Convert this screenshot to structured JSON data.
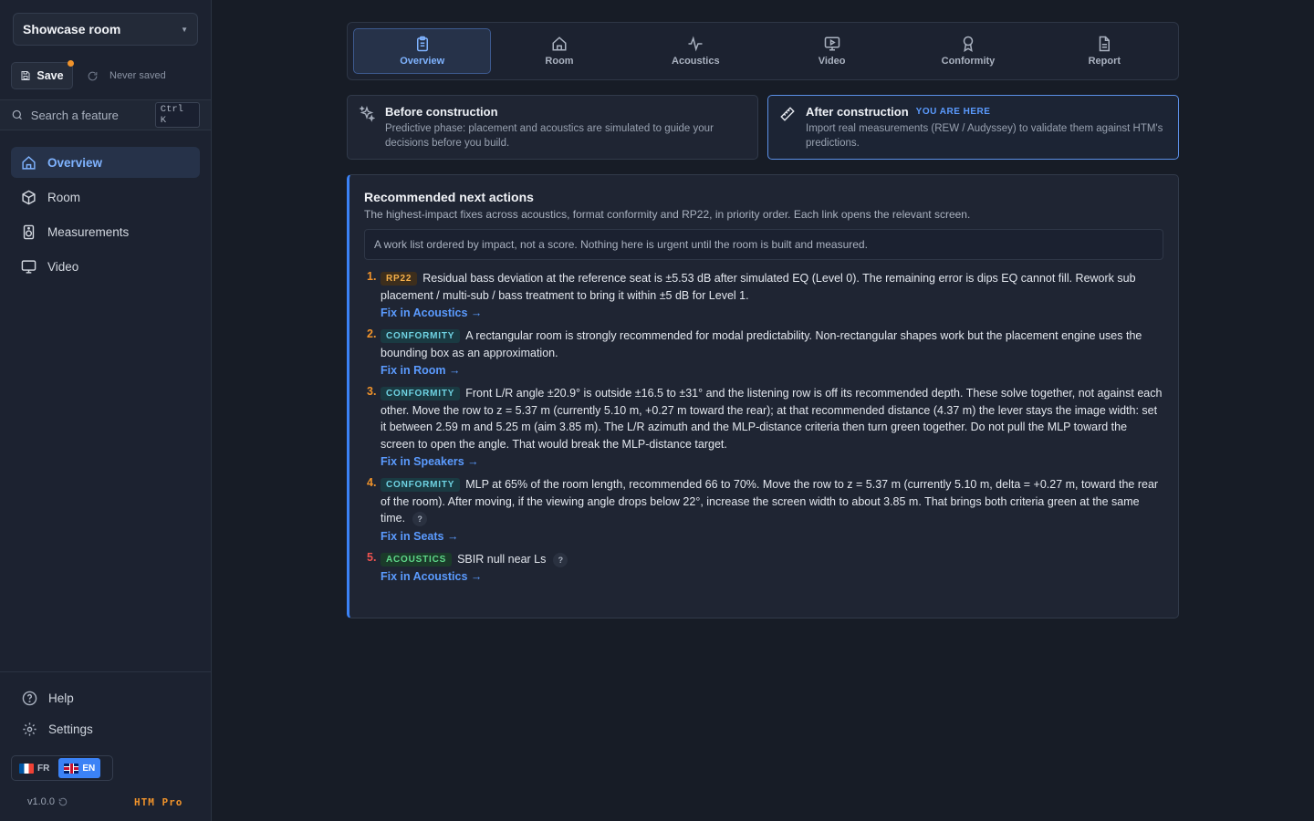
{
  "sidebar": {
    "room_selector": "Showcase room",
    "save_label": "Save",
    "save_status": "Never saved",
    "search_placeholder": "Search a feature",
    "search_shortcut": "Ctrl K",
    "nav": [
      {
        "label": "Overview",
        "icon": "home-icon",
        "active": true
      },
      {
        "label": "Room",
        "icon": "cube-icon",
        "active": false
      },
      {
        "label": "Measurements",
        "icon": "speaker-icon",
        "active": false
      },
      {
        "label": "Video",
        "icon": "monitor-icon",
        "active": false
      }
    ],
    "help_label": "Help",
    "settings_label": "Settings",
    "lang_fr": "FR",
    "lang_en": "EN",
    "version": "v1.0.0",
    "brand": "HTM Pro"
  },
  "tabs": [
    {
      "label": "Overview",
      "icon": "clipboard-icon",
      "active": true
    },
    {
      "label": "Room",
      "icon": "home-icon",
      "active": false
    },
    {
      "label": "Acoustics",
      "icon": "pulse-icon",
      "active": false
    },
    {
      "label": "Video",
      "icon": "video-icon",
      "active": false
    },
    {
      "label": "Conformity",
      "icon": "award-icon",
      "active": false
    },
    {
      "label": "Report",
      "icon": "document-icon",
      "active": false
    }
  ],
  "phases": {
    "before": {
      "title": "Before construction",
      "desc": "Predictive phase: placement and acoustics are simulated to guide your decisions before you build."
    },
    "after": {
      "title": "After construction",
      "tag": "YOU ARE HERE",
      "desc": "Import real measurements (REW / Audyssey) to validate them against HTM's predictions."
    }
  },
  "actions": {
    "title": "Recommended next actions",
    "subtitle": "The highest-impact fixes across acoustics, format conformity and RP22, in priority order. Each link opens the relevant screen.",
    "note": "A work list ordered by impact, not a score. Nothing here is urgent until the room is built and measured.",
    "items": [
      {
        "num": "1.",
        "badge": "RP22",
        "text": "Residual bass deviation at the reference seat is ±5.53 dB after simulated EQ (Level 0). The remaining error is dips EQ cannot fill. Rework sub placement / multi-sub / bass treatment to bring it within ±5 dB for Level 1.",
        "link": "Fix in Acoustics →"
      },
      {
        "num": "2.",
        "badge": "CONFORMITY",
        "text": "A rectangular room is strongly recommended for modal predictability. Non-rectangular shapes work but the placement engine uses the bounding box as an approximation.",
        "link": "Fix in Room →"
      },
      {
        "num": "3.",
        "badge": "CONFORMITY",
        "text": "Front L/R angle ±20.9° is outside ±16.5 to ±31° and the listening row is off its recommended depth. These solve together, not against each other. Move the row to z = 5.37 m (currently 5.10 m, +0.27 m toward the rear); at that recommended distance (4.37 m) the lever stays the image width: set it between 2.59 m and 5.25 m (aim 3.85 m). The L/R azimuth and the MLP-distance criteria then turn green together. Do not pull the MLP toward the screen to open the angle. That would break the MLP-distance target.",
        "link": "Fix in Speakers →"
      },
      {
        "num": "4.",
        "badge": "CONFORMITY",
        "text": "MLP at 65% of the room length, recommended 66 to 70%. Move the row to z = 5.37 m (currently 5.10 m, delta = +0.27 m, toward the rear of the room). After moving, if the viewing angle drops below 22°, increase the screen width to about 3.85 m. That brings both criteria green at the same time.",
        "help": "?",
        "link": "Fix in Seats →"
      },
      {
        "num": "5.",
        "badge": "ACOUSTICS",
        "text": "SBIR null near Ls",
        "help": "?",
        "link": "Fix in Acoustics →"
      }
    ]
  },
  "colors": {
    "accent": "#3b82f6",
    "num_1": "#f0932b",
    "num_2": "#f0932b",
    "num_3": "#f0932b",
    "num_4": "#f0932b",
    "num_5": "#ef5350"
  }
}
